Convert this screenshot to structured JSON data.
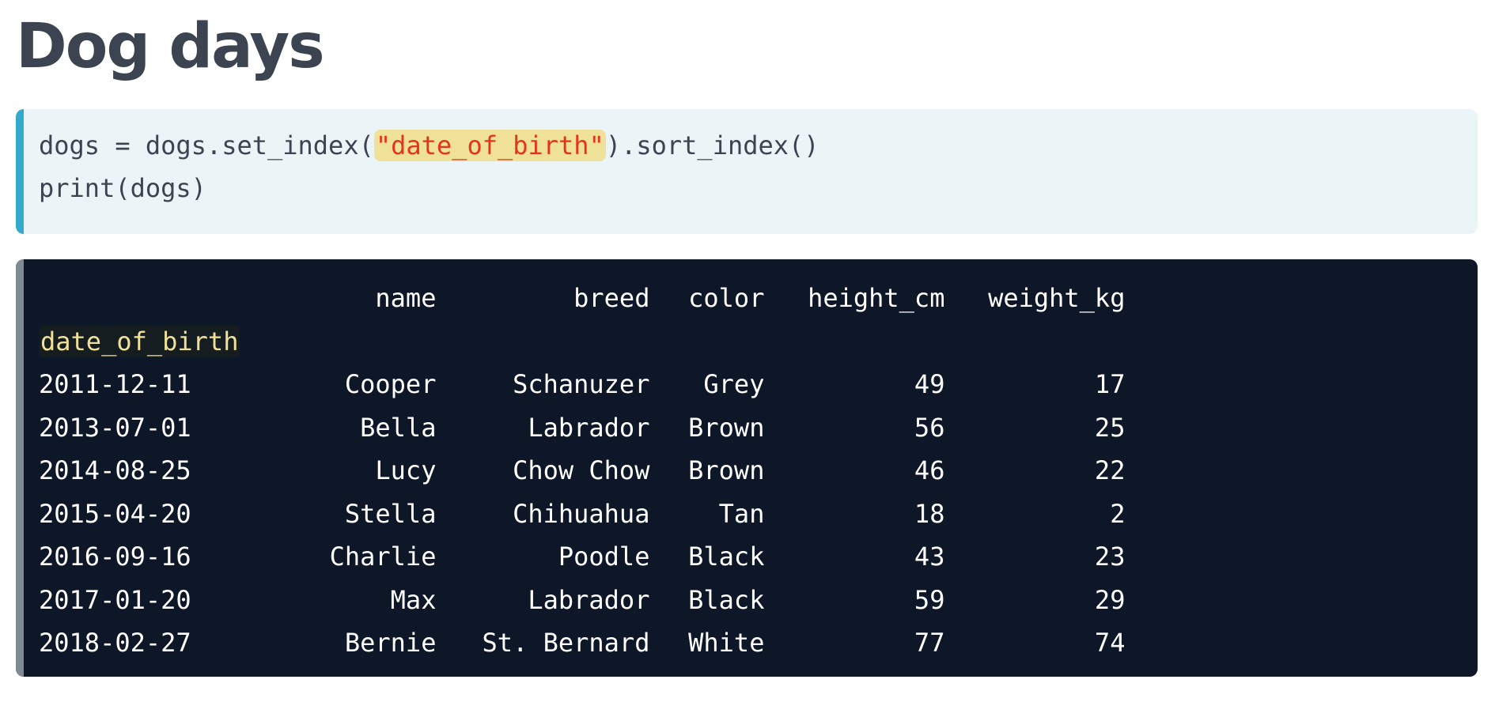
{
  "title": "Dog days",
  "code": {
    "line1_prefix": "dogs = dogs.set_index(",
    "line1_string": "\"date_of_birth\"",
    "line1_suffix": ").sort_index()",
    "line2": "print(dogs)"
  },
  "output": {
    "columns": [
      "name",
      "breed",
      "color",
      "height_cm",
      "weight_kg"
    ],
    "index_name": "date_of_birth",
    "rows": [
      [
        "2011-12-11",
        "Cooper",
        "Schanuzer",
        "Grey",
        "49",
        "17"
      ],
      [
        "2013-07-01",
        "Bella",
        "Labrador",
        "Brown",
        "56",
        "25"
      ],
      [
        "2014-08-25",
        "Lucy",
        "Chow Chow",
        "Brown",
        "46",
        "22"
      ],
      [
        "2015-04-20",
        "Stella",
        "Chihuahua",
        "Tan",
        "18",
        "2"
      ],
      [
        "2016-09-16",
        "Charlie",
        "Poodle",
        "Black",
        "43",
        "23"
      ],
      [
        "2017-01-20",
        "Max",
        "Labrador",
        "Black",
        "59",
        "29"
      ],
      [
        "2018-02-27",
        "Bernie",
        "St. Bernard",
        "White",
        "77",
        "74"
      ]
    ]
  }
}
